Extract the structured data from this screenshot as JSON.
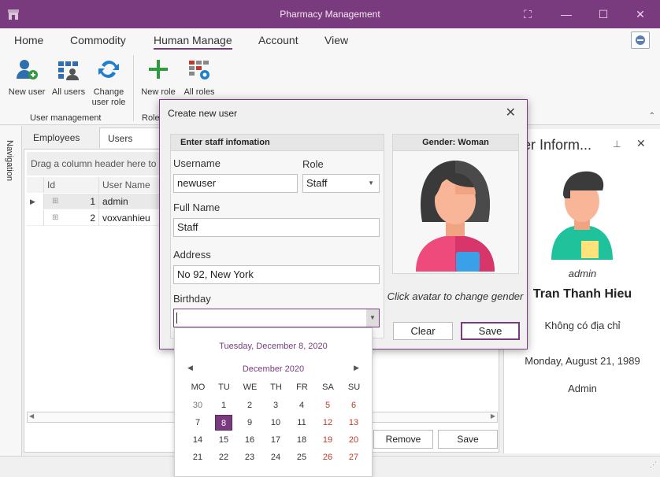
{
  "window": {
    "title": "Pharmacy Management"
  },
  "menu": [
    "Home",
    "Commodity",
    "Human Manage",
    "Account",
    "View"
  ],
  "ribbon": {
    "buttons": [
      {
        "label1": "New user",
        "label2": ""
      },
      {
        "label1": "All users",
        "label2": ""
      },
      {
        "label1": "Change",
        "label2": "user role"
      },
      {
        "label1": "New role",
        "label2": ""
      },
      {
        "label1": "All roles",
        "label2": ""
      }
    ],
    "groups": [
      "User management",
      "Role"
    ]
  },
  "navigation": {
    "label": "Navigation"
  },
  "tabs": [
    "Employees",
    "Users"
  ],
  "grid": {
    "drag_hint": "Drag a column header here to g",
    "columns": [
      "Id",
      "User Name"
    ],
    "rows": [
      {
        "id": "1",
        "name": "admin"
      },
      {
        "id": "2",
        "name": "voxvanhieu"
      }
    ]
  },
  "bottom_buttons": {
    "remove": "Remove",
    "save": "Save"
  },
  "user_info": {
    "title": "er Inform...",
    "username": "admin",
    "fullname": "Tran Thanh Hieu",
    "address": "Không có địa chỉ",
    "birthday": "Monday, August 21, 1989",
    "role": "Admin"
  },
  "dialog": {
    "title": "Create new user",
    "staff_header": "Enter staff infomation",
    "username_label": "Username",
    "username_value": "newuser",
    "role_label": "Role",
    "role_value": "Staff",
    "fullname_label": "Full Name",
    "fullname_value": "Staff",
    "address_label": "Address",
    "address_value": "No 92, New York",
    "birthday_label": "Birthday",
    "birthday_value": "",
    "gender_header": "Gender: Woman",
    "gender_hint": "Click avatar to change gender",
    "clear_label": "Clear",
    "save_label": "Save"
  },
  "calendar": {
    "today_label": "Tuesday, December 8, 2020",
    "month_label": "December 2020",
    "days_of_week": [
      "MO",
      "TU",
      "WE",
      "TH",
      "FR",
      "SA",
      "SU"
    ],
    "weeks": [
      [
        "30",
        "1",
        "2",
        "3",
        "4",
        "5",
        "6"
      ],
      [
        "7",
        "8",
        "9",
        "10",
        "11",
        "12",
        "13"
      ],
      [
        "14",
        "15",
        "16",
        "17",
        "18",
        "19",
        "20"
      ],
      [
        "21",
        "22",
        "23",
        "24",
        "25",
        "26",
        "27"
      ]
    ],
    "selected_day": "8"
  },
  "colors": {
    "accent": "#7a3b7e",
    "weekend": "#c0392b"
  }
}
